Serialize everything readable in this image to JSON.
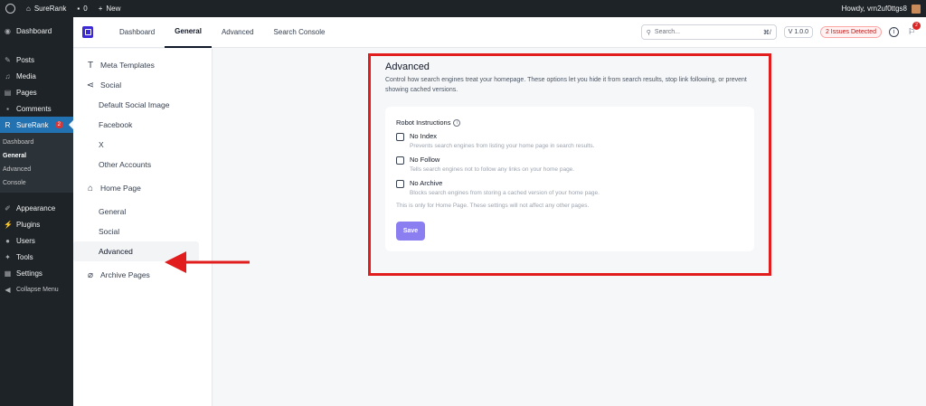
{
  "adminbar": {
    "site_name": "SureRank",
    "comments_count": "0",
    "new_label": "New",
    "howdy": "Howdy, vrn2uf0ttgs8"
  },
  "wp_menu": {
    "dashboard": "Dashboard",
    "posts": "Posts",
    "media": "Media",
    "pages": "Pages",
    "comments": "Comments",
    "surerank": "SureRank",
    "surerank_badge": "2",
    "submenu": [
      "Dashboard",
      "General",
      "Advanced",
      "Console"
    ],
    "appearance": "Appearance",
    "plugins": "Plugins",
    "users": "Users",
    "tools": "Tools",
    "settings": "Settings",
    "collapse": "Collapse Menu"
  },
  "header": {
    "tabs": [
      "Dashboard",
      "General",
      "Advanced",
      "Search Console"
    ],
    "active_tab": "General",
    "search_placeholder": "Search...",
    "search_shortcut": "⌘/",
    "version": "V 1.0.0",
    "issues": "2 Issues Detected",
    "notif_count": "2"
  },
  "settings_nav": {
    "meta_templates": "Meta Templates",
    "social": "Social",
    "social_items": [
      "Default Social Image",
      "Facebook",
      "X",
      "Other Accounts"
    ],
    "home_page": "Home Page",
    "home_items": [
      "General",
      "Social",
      "Advanced"
    ],
    "archive_pages": "Archive Pages"
  },
  "main": {
    "title": "Advanced",
    "description": "Control how search engines treat your homepage. These options let you hide it from search results, stop link following, or prevent showing cached versions.",
    "robot_label": "Robot Instructions",
    "options": [
      {
        "title": "No Index",
        "desc": "Prevents search engines from listing your home page in search results."
      },
      {
        "title": "No Follow",
        "desc": "Tells search engines not to follow any links on your home page."
      },
      {
        "title": "No Archive",
        "desc": "Blocks search engines from storing a cached version of your home page."
      }
    ],
    "note": "This is only for Home Page. These settings will not affect any other pages.",
    "save_label": "Save"
  },
  "colors": {
    "annotation_red": "#e11d1d",
    "brand": "#3b2ad6",
    "save_button": "#8b7ef0",
    "wp_active": "#2271b1"
  }
}
